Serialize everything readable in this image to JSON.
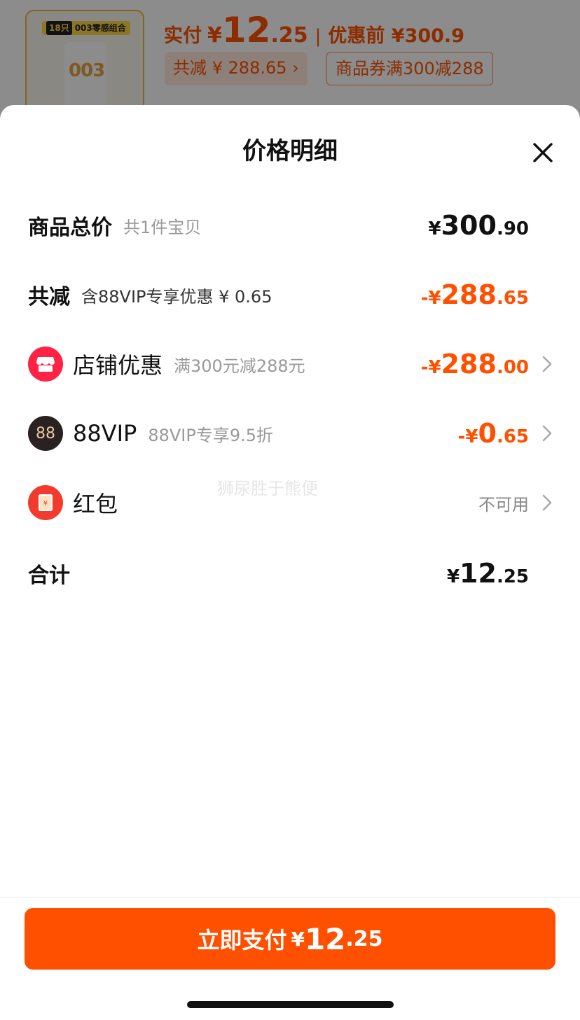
{
  "background": {
    "thumb_tag_count": "18只",
    "thumb_tag_text": "003零感组合",
    "thumb_logo": "003",
    "price_label": "实付",
    "price_yen": "¥",
    "price_int": "12",
    "price_dec": ".25",
    "separator": "|",
    "price_before": "优惠前 ¥300.9",
    "saved_chip": "共减 ¥ 288.65 ›",
    "coupon_chip": "商品券满300减288"
  },
  "sheet": {
    "title": "价格明细",
    "close_icon": "close-icon",
    "rows": {
      "total": {
        "label": "商品总价",
        "sub": "共1件宝贝",
        "yen": "¥",
        "int": "300",
        "dec": ".90"
      },
      "reduce": {
        "label": "共减",
        "sub": "含88VIP专享优惠 ¥ 0.65",
        "yen": "-¥",
        "int": "288",
        "dec": ".65"
      },
      "shop": {
        "label": "店铺优惠",
        "sub": "满300元减288元",
        "yen": "-¥",
        "int": "288",
        "dec": ".00",
        "icon": "store-icon"
      },
      "vip": {
        "label": "88VIP",
        "sub": "88VIP专享9.5折",
        "yen": "-¥",
        "int": "0",
        "dec": ".65",
        "icon_text": "88"
      },
      "hongbao": {
        "label": "红包",
        "value": "不可用",
        "icon": "red-envelope-icon"
      },
      "sum": {
        "label": "合计",
        "yen": "¥",
        "int": "12",
        "dec": ".25"
      }
    },
    "watermark": "狮尿胜于熊便"
  },
  "pay_button": {
    "label": "立即支付",
    "yen": "¥",
    "int": "12",
    "dec": ".25"
  },
  "colors": {
    "accent": "#ff5000",
    "shop_icon": "#ff2244",
    "vip_icon": "#2a2220",
    "hongbao_icon": "#f23b2c"
  }
}
